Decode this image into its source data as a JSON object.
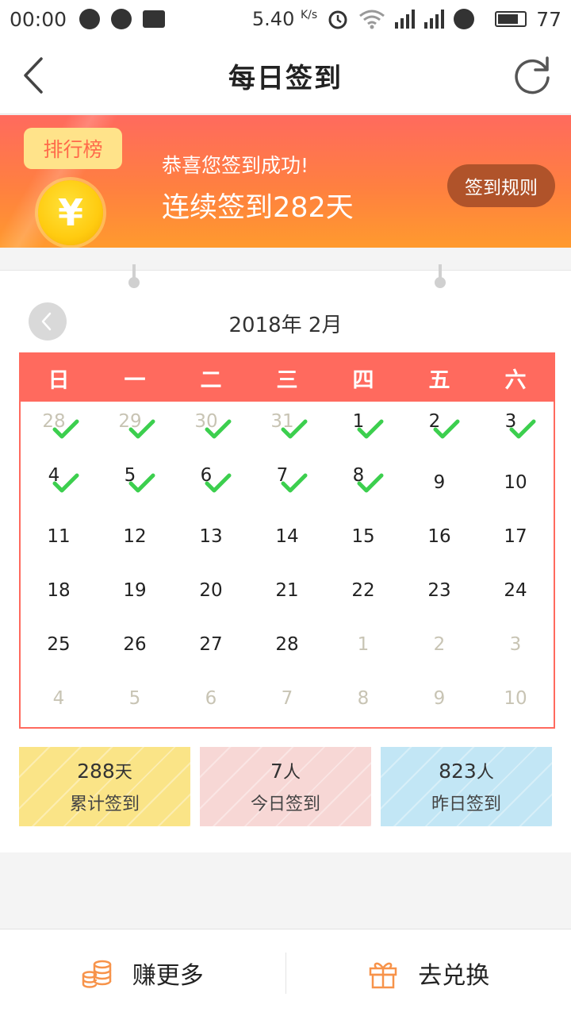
{
  "status_bar": {
    "time": "00:00",
    "speed": "5.40",
    "speed_unit": "K/s",
    "network": "4G",
    "battery": "77"
  },
  "nav": {
    "title": "每日签到",
    "back_icon": "chevron-left-icon",
    "refresh_icon": "refresh-icon"
  },
  "banner": {
    "rank_tag": "排行榜",
    "coin_symbol": "¥",
    "line1": "恭喜您签到成功!",
    "line2": "连续签到282天",
    "rules_button": "签到规则"
  },
  "calendar": {
    "title": "2018年 2月",
    "weekdays": [
      "日",
      "一",
      "二",
      "三",
      "四",
      "五",
      "六"
    ],
    "days": [
      {
        "d": "28",
        "other": true,
        "checked": true
      },
      {
        "d": "29",
        "other": true,
        "checked": true
      },
      {
        "d": "30",
        "other": true,
        "checked": true
      },
      {
        "d": "31",
        "other": true,
        "checked": true
      },
      {
        "d": "1",
        "other": false,
        "checked": true
      },
      {
        "d": "2",
        "other": false,
        "checked": true
      },
      {
        "d": "3",
        "other": false,
        "checked": true
      },
      {
        "d": "4",
        "other": false,
        "checked": true
      },
      {
        "d": "5",
        "other": false,
        "checked": true
      },
      {
        "d": "6",
        "other": false,
        "checked": true
      },
      {
        "d": "7",
        "other": false,
        "checked": true
      },
      {
        "d": "8",
        "other": false,
        "checked": true
      },
      {
        "d": "9",
        "other": false,
        "checked": false
      },
      {
        "d": "10",
        "other": false,
        "checked": false
      },
      {
        "d": "11",
        "other": false,
        "checked": false
      },
      {
        "d": "12",
        "other": false,
        "checked": false
      },
      {
        "d": "13",
        "other": false,
        "checked": false
      },
      {
        "d": "14",
        "other": false,
        "checked": false
      },
      {
        "d": "15",
        "other": false,
        "checked": false
      },
      {
        "d": "16",
        "other": false,
        "checked": false
      },
      {
        "d": "17",
        "other": false,
        "checked": false
      },
      {
        "d": "18",
        "other": false,
        "checked": false
      },
      {
        "d": "19",
        "other": false,
        "checked": false
      },
      {
        "d": "20",
        "other": false,
        "checked": false
      },
      {
        "d": "21",
        "other": false,
        "checked": false
      },
      {
        "d": "22",
        "other": false,
        "checked": false
      },
      {
        "d": "23",
        "other": false,
        "checked": false
      },
      {
        "d": "24",
        "other": false,
        "checked": false
      },
      {
        "d": "25",
        "other": false,
        "checked": false
      },
      {
        "d": "26",
        "other": false,
        "checked": false
      },
      {
        "d": "27",
        "other": false,
        "checked": false
      },
      {
        "d": "28",
        "other": false,
        "checked": false
      },
      {
        "d": "1",
        "other": true,
        "checked": false
      },
      {
        "d": "2",
        "other": true,
        "checked": false
      },
      {
        "d": "3",
        "other": true,
        "checked": false
      },
      {
        "d": "4",
        "other": true,
        "checked": false
      },
      {
        "d": "5",
        "other": true,
        "checked": false
      },
      {
        "d": "6",
        "other": true,
        "checked": false
      },
      {
        "d": "7",
        "other": true,
        "checked": false
      },
      {
        "d": "8",
        "other": true,
        "checked": false
      },
      {
        "d": "9",
        "other": true,
        "checked": false
      },
      {
        "d": "10",
        "other": true,
        "checked": false
      }
    ]
  },
  "stats": {
    "total": {
      "value": "288",
      "unit": "天",
      "label": "累计签到"
    },
    "today": {
      "value": "7",
      "unit": "人",
      "label": "今日签到"
    },
    "yesterday": {
      "value": "823",
      "unit": "人",
      "label": "昨日签到"
    }
  },
  "bottom": {
    "earn_label": "赚更多",
    "earn_icon": "coins-icon",
    "exchange_label": "去兑换",
    "exchange_icon": "gift-icon"
  },
  "colors": {
    "accent": "#ff6a5e",
    "check": "#3ccf4e",
    "icon_orange": "#f7934a"
  }
}
